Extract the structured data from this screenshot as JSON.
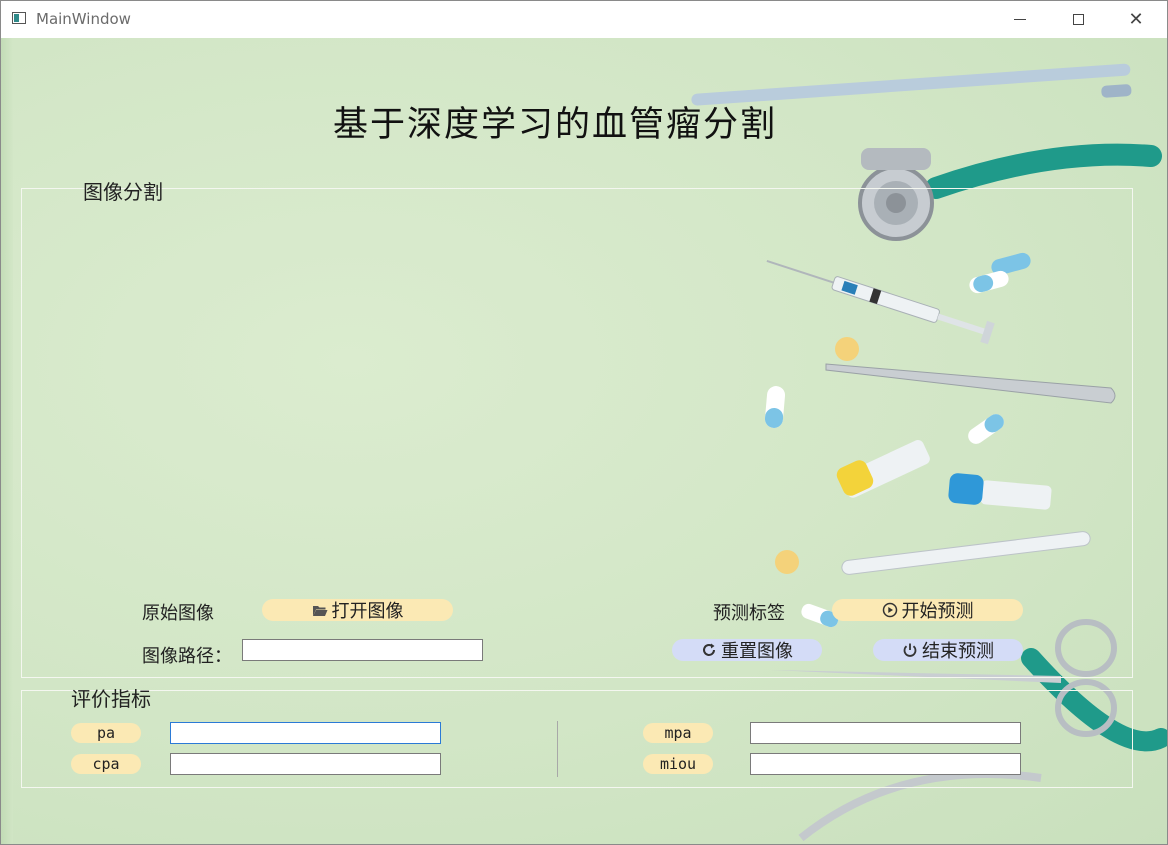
{
  "window": {
    "title": "MainWindow"
  },
  "header": {
    "title": "基于深度学习的血管瘤分割"
  },
  "segmentation_group": {
    "title": "图像分割",
    "original_image_label": "原始图像",
    "open_image_button": "打开图像",
    "image_path_label": "图像路径：",
    "image_path_value": "",
    "predicted_label": "预测标签",
    "start_predict_button": "开始预测",
    "reset_image_button": "重置图像",
    "end_predict_button": "结束预测"
  },
  "evaluation_group": {
    "title": "评价指标",
    "metrics": [
      {
        "name": "pa",
        "value": ""
      },
      {
        "name": "cpa",
        "value": ""
      },
      {
        "name": "mpa",
        "value": ""
      },
      {
        "name": "miou",
        "value": ""
      }
    ]
  },
  "colors": {
    "background": "#d2e6c6",
    "yellow_button": "#fbe9b4",
    "blue_button": "#d4dcf7",
    "teal_tube": "#1f9a8a"
  },
  "icons": {
    "open_image": "folder-open-icon",
    "start_predict": "play-circle-icon",
    "reset_image": "refresh-icon",
    "end_predict": "power-icon"
  }
}
